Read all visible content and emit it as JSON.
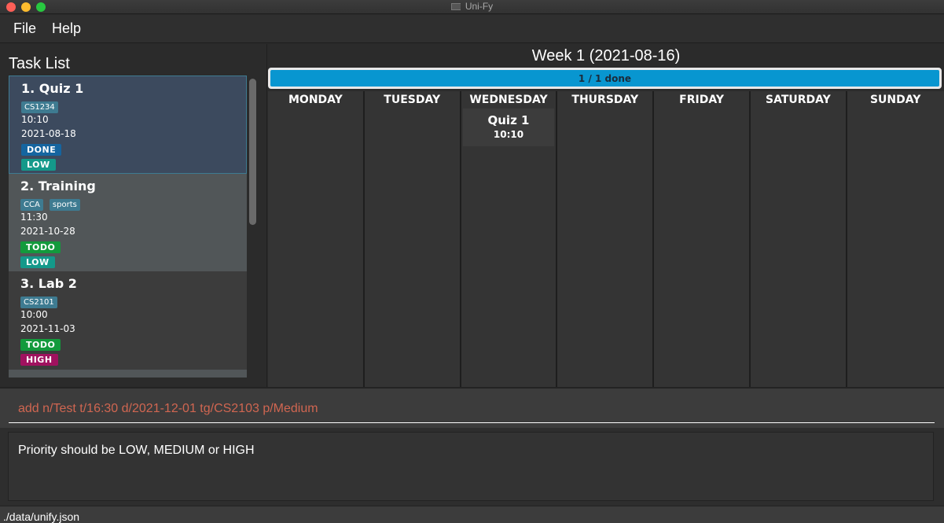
{
  "window": {
    "title": "Uni-Fy"
  },
  "menu": {
    "file": "File",
    "help": "Help"
  },
  "task_panel": {
    "title": "Task List",
    "tasks": [
      {
        "title": "1.  Quiz 1",
        "tags": [
          "CS1234"
        ],
        "time": "10:10",
        "date": "2021-08-18",
        "state": "DONE",
        "priority": "LOW"
      },
      {
        "title": "2.  Training",
        "tags": [
          "CCA",
          "sports"
        ],
        "time": "11:30",
        "date": "2021-10-28",
        "state": "TODO",
        "priority": "LOW"
      },
      {
        "title": "3.  Lab 2",
        "tags": [
          "CS2101"
        ],
        "time": "10:00",
        "date": "2021-11-03",
        "state": "TODO",
        "priority": "HIGH"
      }
    ]
  },
  "calendar": {
    "week_title": "Week 1 (2021-08-16)",
    "progress_text": "1 / 1 done",
    "progress_fraction": 1.0,
    "days": [
      "MONDAY",
      "TUESDAY",
      "WEDNESDAY",
      "THURSDAY",
      "FRIDAY",
      "SATURDAY",
      "SUNDAY"
    ],
    "events": {
      "wednesday": {
        "name": "Quiz 1",
        "time": "10:10"
      }
    }
  },
  "command_box": {
    "value": "add n/Test t/16:30 d/2021-12-01 tg/CS2103 p/Medium"
  },
  "result_box": {
    "text": "Priority should be LOW, MEDIUM or HIGH"
  },
  "status_bar": {
    "path": "./data/unify.json"
  },
  "colors": {
    "tag": "#3e7b91",
    "done": "#1565a0",
    "todo": "#139a3c",
    "low": "#14998a",
    "high": "#a0125f",
    "progress": "#0896d0",
    "command_error_text": "#d06651"
  }
}
